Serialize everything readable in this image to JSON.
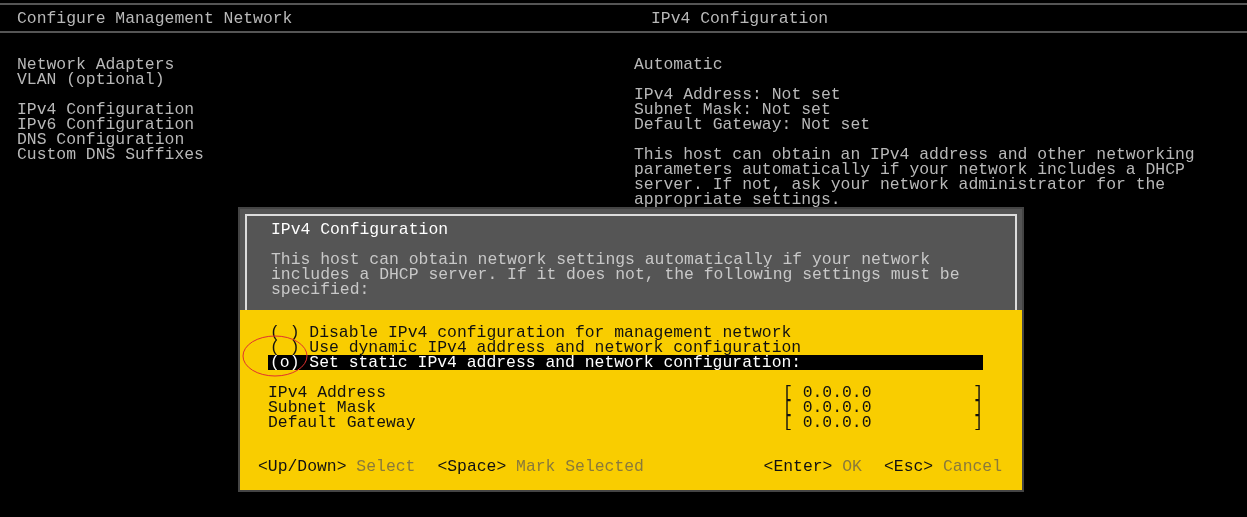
{
  "left_pane": {
    "title": "Configure Management Network",
    "groups": [
      {
        "items": [
          {
            "label": "Network Adapters"
          },
          {
            "label": "VLAN (optional)"
          }
        ]
      },
      {
        "items": [
          {
            "label": "IPv4 Configuration"
          },
          {
            "label": "IPv6 Configuration"
          },
          {
            "label": "DNS Configuration"
          },
          {
            "label": "Custom DNS Suffixes"
          }
        ]
      }
    ]
  },
  "right_pane": {
    "title": "IPv4 Configuration",
    "mode": "Automatic",
    "status": [
      {
        "label": "IPv4 Address:",
        "value": "Not set"
      },
      {
        "label": "Subnet Mask:",
        "value": "Not set"
      },
      {
        "label": "Default Gateway:",
        "value": "Not set"
      }
    ],
    "description": "This host can obtain an IPv4 address and other networking parameters automatically if your network includes a DHCP server. If not, ask your network administrator for the appropriate settings."
  },
  "dialog": {
    "title": "IPv4 Configuration",
    "description": "This host can obtain network settings automatically if your network includes a DHCP server. If it does not, the following settings must be specified:",
    "options": [
      {
        "mark": "( )",
        "label": "Disable IPv4 configuration for management network",
        "selected": false
      },
      {
        "mark": "( )",
        "label": "Use dynamic IPv4 address and network configuration",
        "selected": false
      },
      {
        "mark": "(o)",
        "label": "Set static IPv4 address and network configuration:",
        "selected": true
      }
    ],
    "fields": [
      {
        "label": "IPv4 Address",
        "open": "[",
        "value": "0.0.0.0",
        "close": "]"
      },
      {
        "label": "Subnet Mask",
        "open": "[",
        "value": "0.0.0.0",
        "close": "]"
      },
      {
        "label": "Default Gateway",
        "open": "[",
        "value": "0.0.0.0",
        "close": "]"
      }
    ],
    "footer_left": [
      {
        "key": "<Up/Down>",
        "action": "Select"
      },
      {
        "key": "<Space>",
        "action": "Mark Selected"
      }
    ],
    "footer_right": [
      {
        "key": "<Enter>",
        "action": "OK"
      },
      {
        "key": "<Esc>",
        "action": "Cancel"
      }
    ]
  },
  "annotations": [
    {
      "kind": "ellipse"
    }
  ]
}
